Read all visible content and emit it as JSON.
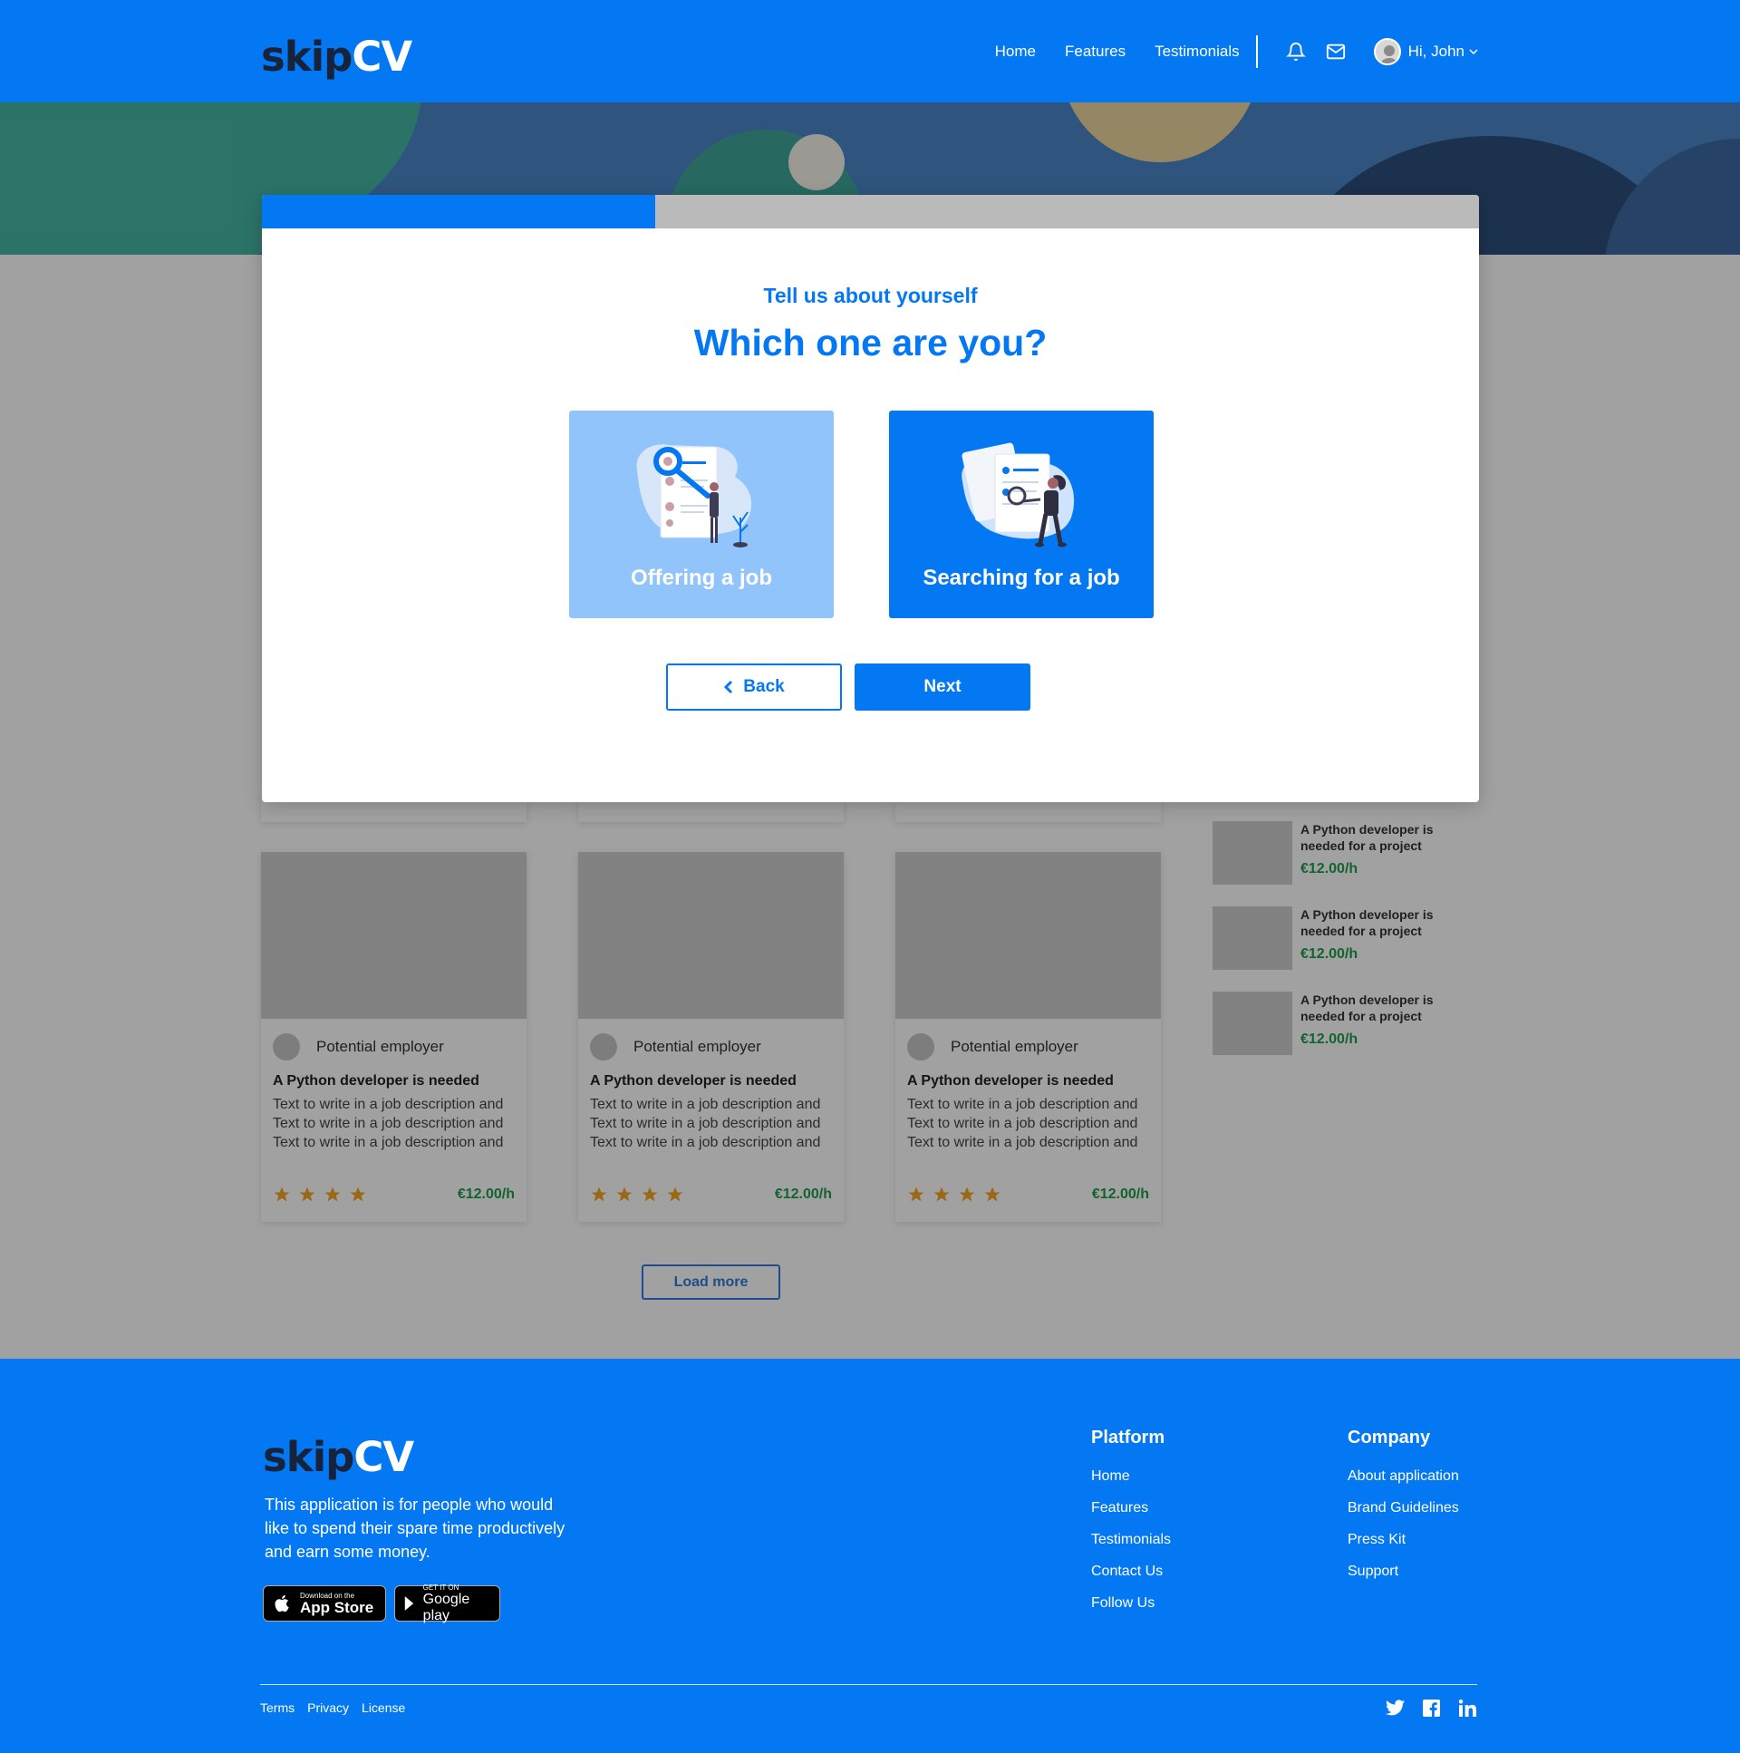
{
  "brand": {
    "logo_dark": "skip",
    "logo_light": "CV",
    "accent": "#0478f2",
    "dark": "#17223b"
  },
  "header": {
    "nav": [
      "Home",
      "Features",
      "Testimonials"
    ],
    "icons": [
      "bell-icon",
      "mail-icon"
    ],
    "greeting": "Hi, John"
  },
  "jobs": {
    "cards": [
      {
        "employer": "Potential employer",
        "title": "A Python developer is needed",
        "description": "Text to write in a job description and Text to write in a job description and Text to write in a job description and",
        "rating": 4,
        "price": "€12.00/h"
      },
      {
        "employer": "Potential employer",
        "title": "A Python developer is needed",
        "description": "Text to write in a job description and Text to write in a job description and Text to write in a job description and",
        "rating": 4,
        "price": "€12.00/h"
      },
      {
        "employer": "Potential employer",
        "title": "A Python developer is needed",
        "description": "Text to write in a job description and Text to write in a job description and Text to write in a job description and",
        "rating": 4,
        "price": "€12.00/h"
      }
    ],
    "side": [
      {
        "title": "A Python developer is needed for a project",
        "price": "€12.00/h"
      },
      {
        "title": "A Python developer is needed for a project",
        "price": "€12.00/h"
      },
      {
        "title": "A Python developer is needed for a project",
        "price": "€12.00/h"
      }
    ],
    "load_more": "Load more"
  },
  "modal": {
    "progress": 0.323,
    "subtitle": "Tell us about yourself",
    "title": "Which one are you?",
    "options": [
      {
        "label": "Offering a job",
        "selected": false,
        "color": "#90c4fb"
      },
      {
        "label": "Searching for a job",
        "selected": true,
        "color": "#0478f2"
      }
    ],
    "back": "Back",
    "next": "Next"
  },
  "footer": {
    "about": "This application is for people who would like to spend their spare time productively and earn some money.",
    "appstore_small": "Download on the",
    "appstore_big": "App Store",
    "gplay_small": "GET IT ON",
    "gplay_big": "Google play",
    "platform": {
      "heading": "Platform",
      "links": [
        "Home",
        "Features",
        "Testimonials",
        "Contact Us",
        "Follow Us"
      ]
    },
    "company": {
      "heading": "Company",
      "links": [
        "About application",
        "Brand Guidelines",
        "Press Kit",
        "Support"
      ]
    },
    "legal": [
      "Terms",
      "Privacy",
      "License"
    ],
    "social": [
      "twitter-icon",
      "facebook-icon",
      "linkedin-icon"
    ]
  }
}
